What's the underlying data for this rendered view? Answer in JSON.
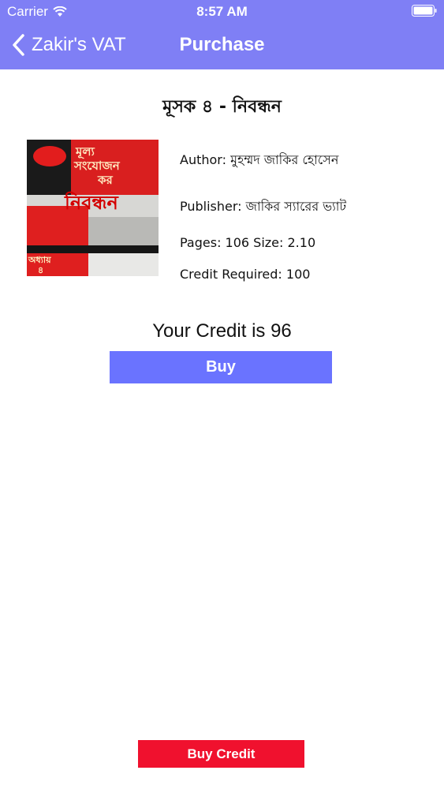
{
  "status_bar": {
    "carrier": "Carrier",
    "time": "8:57 AM"
  },
  "nav": {
    "back_label": "Zakir's VAT",
    "title": "Purchase"
  },
  "book": {
    "title": "মূসক ৪ - নিবন্ধন",
    "author": "Author: মুহম্মদ জাকির হোসেন",
    "publisher": "Publisher: জাকির স্যারের ভ্যাট",
    "pages_size": "Pages: 106 Size: 2.10",
    "credit_required": "Credit Required: 100",
    "cover": {
      "line1": "মূল্য",
      "line2": "সংযোজন",
      "line3": "কর",
      "main": "নিবন্ধন",
      "badge": "অধ্যায়",
      "badge_num": "৪"
    }
  },
  "credit_text": "Your Credit is 96",
  "buy_label": "Buy",
  "buy_credit_label": "Buy Credit",
  "colors": {
    "nav": "#7f7ff5",
    "buy": "#6a73ff",
    "buy_credit": "#f0112e"
  }
}
